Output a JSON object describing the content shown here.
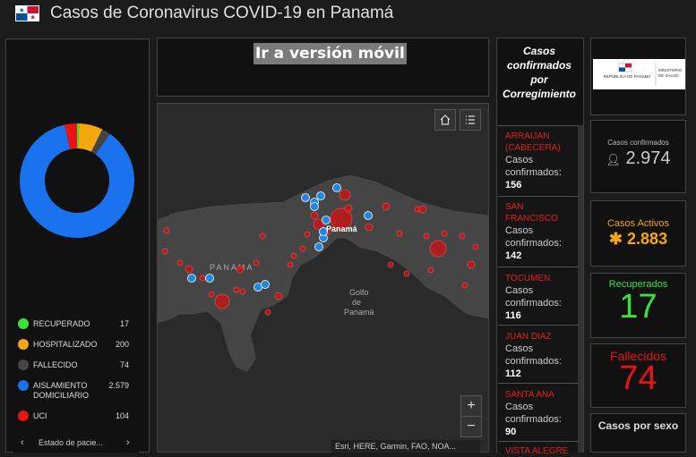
{
  "header": {
    "title": "Casos de Coronavirus COVID-19 en Panamá"
  },
  "colors": {
    "recuperado": "#36e43a",
    "hospitalizado": "#f5a70f",
    "fallecido": "#444444",
    "aislamiento": "#1a72ef",
    "uci": "#e81414",
    "list_name": "#e02020"
  },
  "chart_data": {
    "type": "pie",
    "title": "",
    "categories": [
      "RECUPERADO",
      "HOSPITALIZADO",
      "FALLECIDO",
      "AISLAMIENTO DOMICILIARIO",
      "UCI"
    ],
    "values": [
      17,
      200,
      74,
      2579,
      104
    ]
  },
  "legend": [
    {
      "label": "RECUPERADO",
      "value": "17"
    },
    {
      "label": "HOSPITALIZADO",
      "value": "200"
    },
    {
      "label": "FALLECIDO",
      "value": "74"
    },
    {
      "label": "AISLAMIENTO DOMICILIARIO",
      "value": "2.579"
    },
    {
      "label": "UCI",
      "value": "104"
    }
  ],
  "pager": {
    "label": "Estado de pacie...",
    "prev_icon": "chevron-left-icon",
    "next_icon": "chevron-right-icon"
  },
  "mobile_link": "Ir a versión móvil",
  "map": {
    "labels": {
      "panama_country": "PANAMA",
      "panama_city": "Panamá",
      "golfo_1": "Golfo",
      "golfo_2": "de",
      "golfo_3": "Panamá"
    },
    "attribution": "Esri, HERE, Garmin, FAO, NOA...",
    "zoom_in": "+",
    "zoom_out": "−",
    "home_icon": "home-icon",
    "list_icon": "list-icon"
  },
  "list": {
    "title": "Casos confirmados por Corregimiento",
    "items": [
      {
        "name": "ARRAIJAN (CABECERA)",
        "label": "Casos confirmados:",
        "value": "156"
      },
      {
        "name": "SAN FRANCISCO",
        "label": "Casos confirmados:",
        "value": "142"
      },
      {
        "name": "TOCUMEN",
        "label": "Casos confirmados:",
        "value": "116"
      },
      {
        "name": "JUAN DIAZ",
        "label": "Casos confirmados:",
        "value": "112"
      },
      {
        "name": "SANTA ANA",
        "label": "Casos confirmados:",
        "value": "90"
      },
      {
        "name": "VISTA ALEGRE",
        "label": "",
        "value": ""
      }
    ]
  },
  "logo": {
    "line1": "REPÚBLICA DE PANAMÁ",
    "line2": "MINISTERIO DE SALUD"
  },
  "stats": {
    "confirmados": {
      "label": "Casos confirmados",
      "value": "2.974",
      "icon": "person-icon"
    },
    "activos": {
      "label": "Casos Activos",
      "value": "2.883",
      "icon": "asterisk-icon"
    },
    "recuperados": {
      "label": "Recuperados",
      "value": "17"
    },
    "fallecidos": {
      "label": "Fallecidos",
      "value": "74"
    },
    "sexo": {
      "label": "Casos por sexo"
    }
  }
}
